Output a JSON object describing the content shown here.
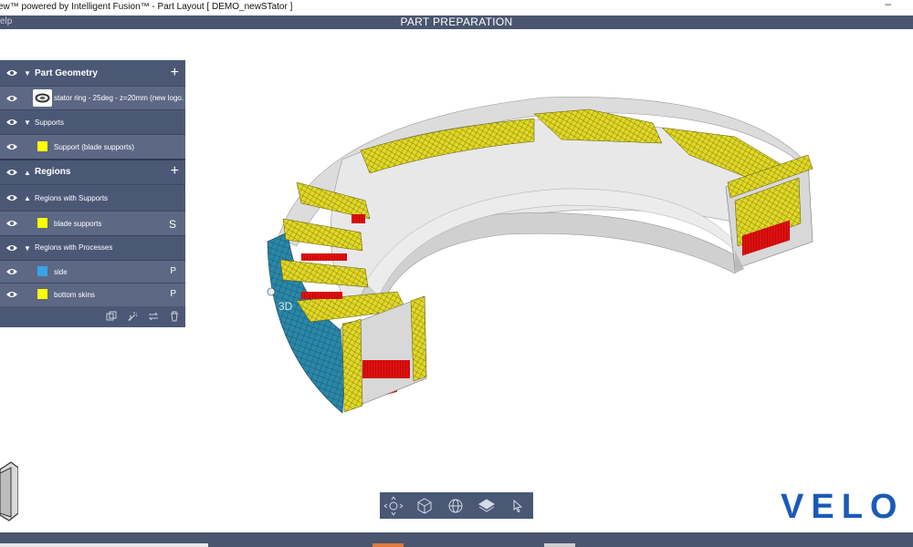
{
  "window": {
    "title": "ew™ powered by Intelligent Fusion™ - Part Layout [ DEMO_newSTator ]",
    "minimize_glyph": "–"
  },
  "appbar": {
    "menu_help": "elp",
    "page_title": "PART PREPARATION"
  },
  "panel": {
    "part_geometry": {
      "label": "Part Geometry",
      "add_glyph": "+"
    },
    "part_item": {
      "label": "stator ring - 25deg - z=20mm (new logo..."
    },
    "supports": {
      "label": "Supports"
    },
    "support_item": {
      "label": "Support (blade supports)",
      "color": "#ffff00"
    },
    "regions": {
      "label": "Regions",
      "add_glyph": "+"
    },
    "regions_with_supports": {
      "label": "Regions with Supports"
    },
    "blade_supports": {
      "label": "blade supports",
      "tag": "S",
      "color": "#ffff00"
    },
    "regions_with_processes": {
      "label": "Regions with Processes"
    },
    "side": {
      "label": "side",
      "tag": "P",
      "color": "#3aa3e8"
    },
    "bottom_skins": {
      "label": "bottom skins",
      "tag": "P",
      "color": "#ffff00"
    },
    "footer_icons": [
      "duplicate-icon",
      "wand-icon",
      "swap-icon",
      "trash-icon"
    ]
  },
  "toolbar": {
    "icons": [
      "move-icon",
      "cube-icon",
      "globe-icon",
      "layers-icon",
      "pointer-icon"
    ]
  },
  "brand": {
    "logo_text": "VELO",
    "color": "#1a5bb8"
  },
  "colors": {
    "panel_bg": "#4a5876",
    "appbar_bg": "#4a556f",
    "model_gray": "#c9c9c9",
    "model_yellow": "#e8e02a",
    "model_red": "#e01010",
    "model_teal": "#2a87a8"
  }
}
